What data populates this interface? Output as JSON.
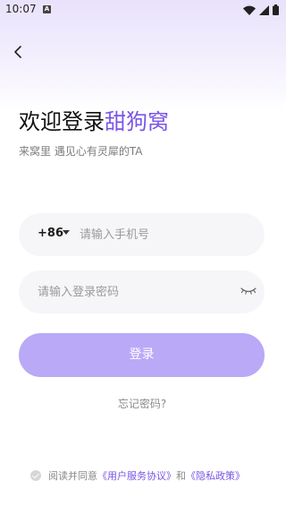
{
  "status_bar": {
    "time": "10:07",
    "notification_badge": "A"
  },
  "header": {
    "title_prefix": "欢迎登录",
    "brand": "甜狗窝",
    "subtitle": "来窝里  遇见心有灵犀的TA"
  },
  "phone": {
    "country_code": "+86",
    "placeholder": "请输入手机号"
  },
  "password": {
    "placeholder": "请输入登录密码"
  },
  "login_button": {
    "label": "登录"
  },
  "forgot_password": {
    "label": "忘记密码?"
  },
  "agreement": {
    "prefix": "阅读并同意",
    "user_agreement": "《用户服务协议》",
    "conjunction": "和",
    "privacy_policy": "《隐私政策》"
  },
  "colors": {
    "accent": "#7a55e6",
    "button": "#b9a9f7",
    "field_bg": "#f6f6f8"
  },
  "icons": {
    "back": "back-arrow-icon",
    "caret": "dropdown-caret-icon",
    "eye": "eye-closed-icon",
    "check": "check-circle-icon",
    "wifi": "wifi-icon",
    "signal": "signal-icon",
    "battery": "battery-icon"
  }
}
